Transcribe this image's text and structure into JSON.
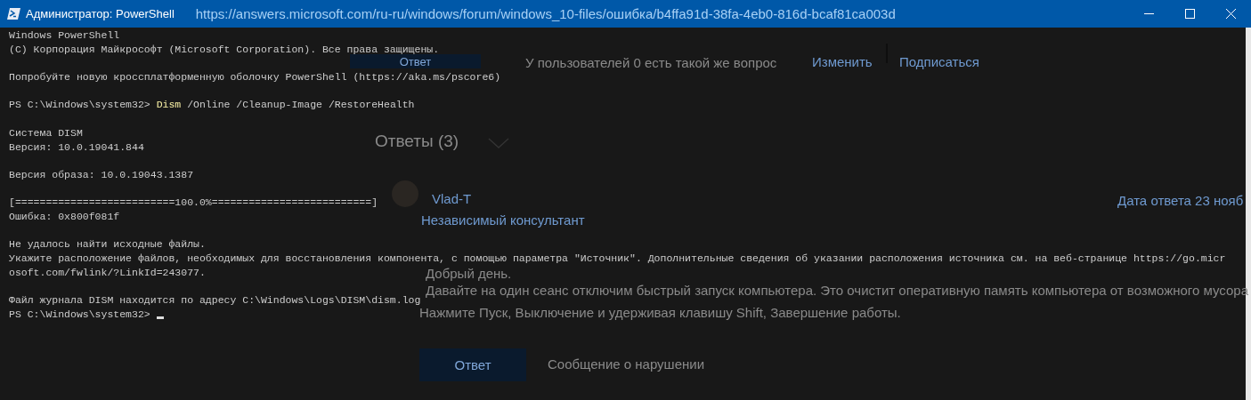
{
  "window": {
    "title": "Администратор: PowerShell",
    "address": "https://answers.microsoft.com/ru-ru/windows/forum/windows_10-files/ошибка/b4ffa91d-38fa-4eb0-816d-bcaf81ca003d"
  },
  "console": {
    "blocks": [
      [
        {
          "kind": "text",
          "text": "Windows PowerShell"
        },
        {
          "kind": "text",
          "text": "(C) Корпорация Майкрософт (Microsoft Corporation). Все права защищены."
        }
      ],
      [
        {
          "kind": "text",
          "text": "Попробуйте новую кроссплатформенную оболочку PowerShell (https://aka.ms/pscore6)"
        }
      ],
      [
        {
          "kind": "prompt",
          "prompt": "PS C:\\Windows\\system32> ",
          "command": "Dism",
          "args": " /Online /Cleanup-Image /RestoreHealth"
        }
      ],
      [
        {
          "kind": "text",
          "text": "Система DISM"
        },
        {
          "kind": "text",
          "text": "Версия: 10.0.19041.844"
        }
      ],
      [
        {
          "kind": "text",
          "text": "Версия образа: 10.0.19043.1387"
        }
      ],
      [
        {
          "kind": "text",
          "text": "[==========================100.0%==========================]"
        },
        {
          "kind": "text",
          "text": "Ошибка: 0x800f081f"
        }
      ],
      [
        {
          "kind": "text",
          "text": "Не удалось найти исходные файлы."
        },
        {
          "kind": "text",
          "text": "Укажите расположение файлов, необходимых для восстановления компонента, с помощью параметра \"Источник\". Дополнительные сведения об указании расположения источника см. на веб-странице https://go.micr"
        },
        {
          "kind": "text",
          "text": "osoft.com/fwlink/?LinkId=243077."
        }
      ],
      [
        {
          "kind": "text",
          "text": "Файл журнала DISM находится по адресу C:\\Windows\\Logs\\DISM\\dism.log"
        },
        {
          "kind": "prompt",
          "prompt": "PS C:\\Windows\\system32> ",
          "cursor": true
        }
      ]
    ]
  },
  "background_page": {
    "reply_button": "Ответ",
    "same_question": "У пользователей 0 есть такой же вопрос",
    "links": [
      "Изменить",
      "Подписаться"
    ],
    "answers_heading": "Ответы (3)",
    "answer": {
      "author": "Vlad-T",
      "role": "Независимый консультант",
      "date": "Дата ответа 23 нояб",
      "greeting": "Добрый день.",
      "paragraphs": [
        "Давайте на один сеанс отключим быстрый запуск компьютера. Это очистит оперативную память компьютера от возможного мусора",
        "Нажмите Пуск, Выключение и удерживая клавишу Shift, Завершение работы."
      ],
      "reply_button": "Ответ",
      "report_link": "Сообщение о нарушении"
    }
  }
}
